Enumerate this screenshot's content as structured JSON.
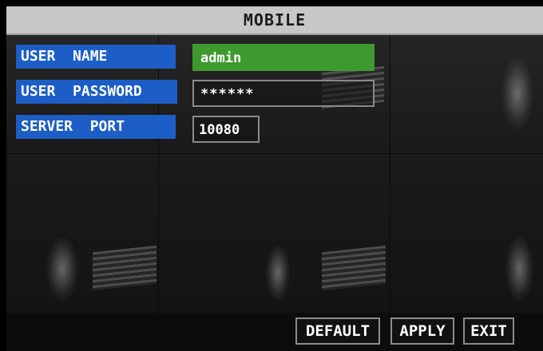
{
  "window": {
    "title": "MOBILE"
  },
  "form": {
    "user_name": {
      "label": "USER  NAME",
      "value": "admin"
    },
    "user_password": {
      "label": "USER  PASSWORD",
      "value": "******"
    },
    "server_port": {
      "label": "SERVER  PORT",
      "value": "10080"
    }
  },
  "buttons": {
    "default": "DEFAULT",
    "apply": "APPLY",
    "exit": "EXIT"
  },
  "colors": {
    "title_bar": "#c7c7c7",
    "label_bg": "#1c5ec6",
    "selected_field": "#3e9a2e",
    "background": "#000000"
  }
}
